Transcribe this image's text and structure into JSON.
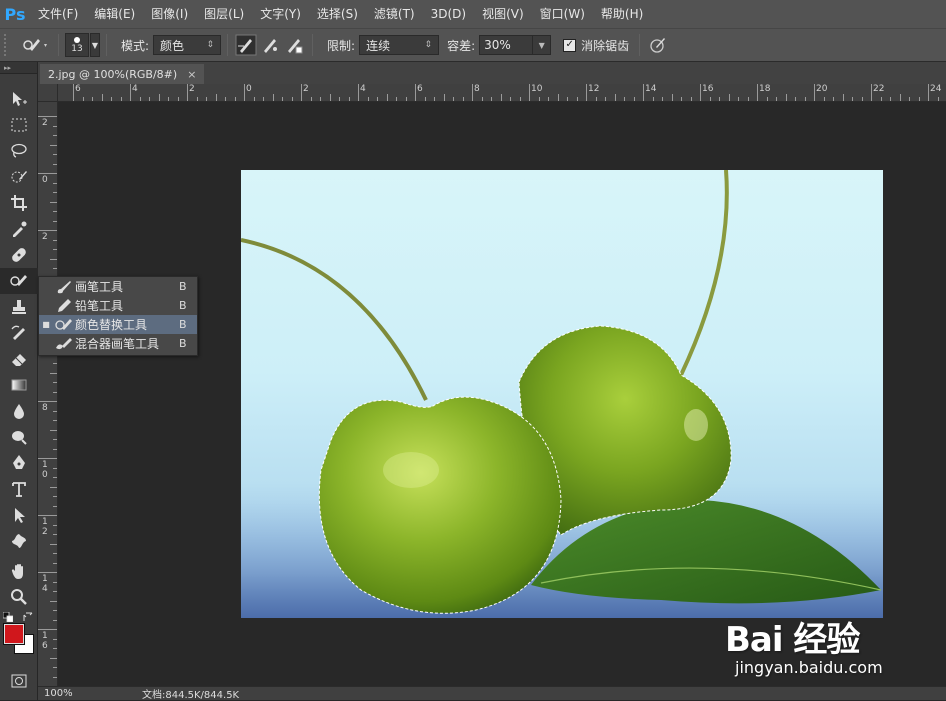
{
  "app": {
    "logo": "Ps"
  },
  "menu": [
    "文件(F)",
    "编辑(E)",
    "图像(I)",
    "图层(L)",
    "文字(Y)",
    "选择(S)",
    "滤镜(T)",
    "3D(D)",
    "视图(V)",
    "窗口(W)",
    "帮助(H)"
  ],
  "options": {
    "brush_size": "13",
    "mode_label": "模式:",
    "mode_value": "颜色",
    "limit_label": "限制:",
    "limit_value": "连续",
    "tolerance_label": "容差:",
    "tolerance_value": "30%",
    "antialias_label": "消除锯齿",
    "antialias_checked": true
  },
  "document": {
    "tab_title": "2.jpg @ 100%(RGB/8#)",
    "close_glyph": "×",
    "h_ruler_labels": [
      "6",
      "4",
      "2",
      "0",
      "2",
      "4",
      "6",
      "8",
      "10",
      "12",
      "14",
      "16",
      "18",
      "20",
      "22",
      "24"
    ],
    "v_ruler_labels": [
      "2",
      "0",
      "2",
      "4",
      "6",
      "8",
      "1\n0",
      "1\n2",
      "1\n4",
      "1\n6"
    ]
  },
  "tool_flyout": {
    "items": [
      {
        "label": "画笔工具",
        "key": "B",
        "selected": false,
        "icon": "brush-icon"
      },
      {
        "label": "铅笔工具",
        "key": "B",
        "selected": false,
        "icon": "pencil-icon"
      },
      {
        "label": "颜色替换工具",
        "key": "B",
        "selected": true,
        "icon": "color-replacement-icon"
      },
      {
        "label": "混合器画笔工具",
        "key": "B",
        "selected": false,
        "icon": "mixer-brush-icon"
      }
    ]
  },
  "colors": {
    "foreground": "#d0171c",
    "background": "#ffffff",
    "accent": "#31a8ff"
  },
  "status": {
    "zoom": "100%",
    "doc_info": "文档:844.5K/844.5K"
  },
  "watermark": {
    "logo": "Bai 经验",
    "url": "jingyan.baidu.com"
  }
}
